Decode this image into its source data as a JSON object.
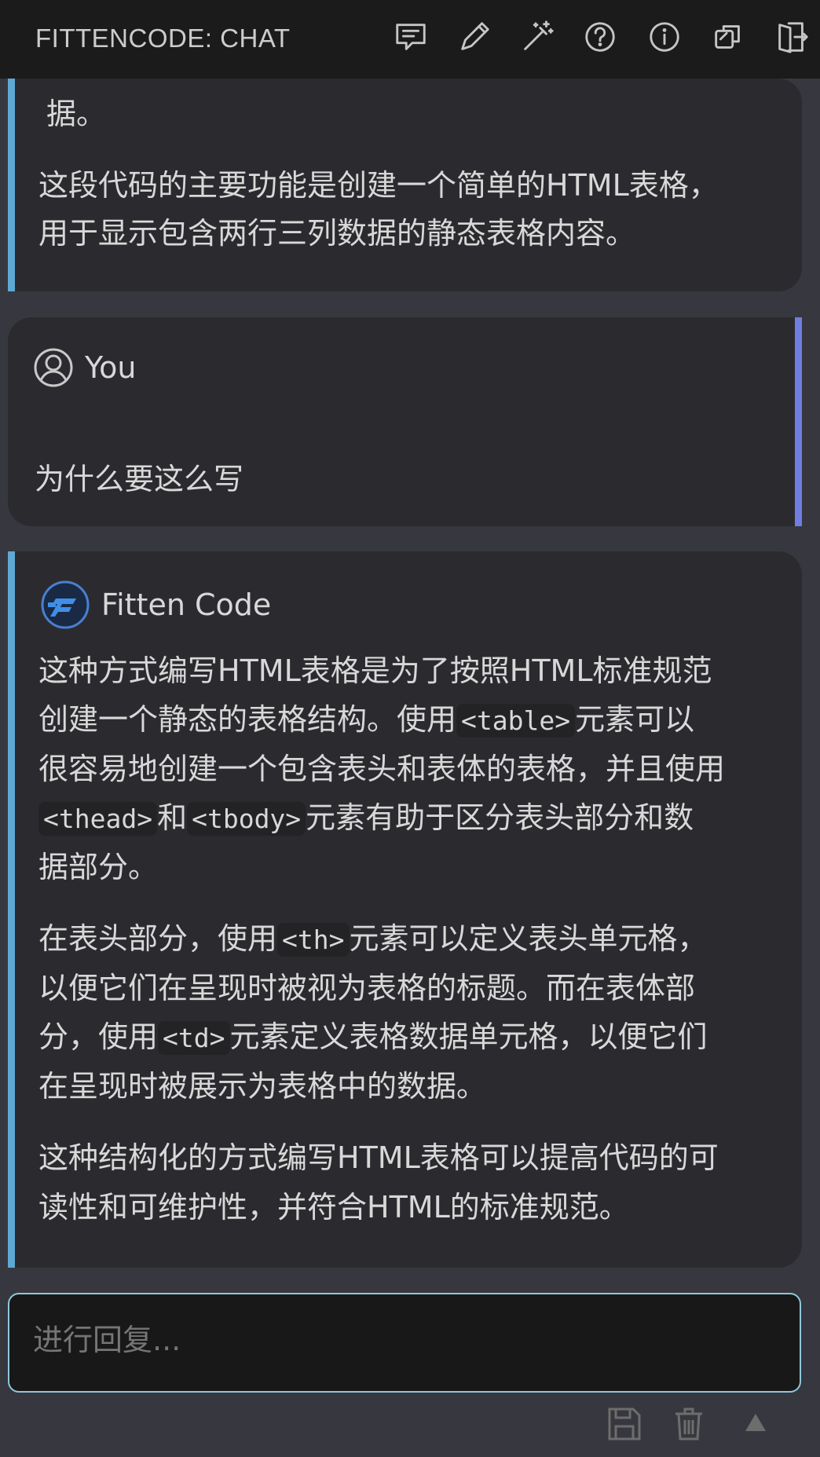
{
  "panel_title": "FITTENCODE: CHAT",
  "toolbar_icons": [
    "new-chat-icon",
    "edit-icon",
    "magic-wand-icon",
    "help-icon",
    "info-icon",
    "copy-icon",
    "exit-icon"
  ],
  "messages": {
    "ai_prev": {
      "line_top": "据。",
      "p2_l1": "这段代码的主要功能是创建一个简单的HTML表格，",
      "p2_l2": "用于显示包含两行三列数据的静态表格内容。"
    },
    "user": {
      "author": "You",
      "text": "为什么要这么写"
    },
    "ai": {
      "author": "Fitten Code",
      "p1_l1": "这种方式编写HTML表格是为了按照HTML标准规范",
      "p1_l2a": "创建一个静态的表格结构。使用",
      "p1_code1": "<table>",
      "p1_l2b": "元素可以",
      "p1_l3": "很容易地创建一个包含表头和表体的表格，并且使用",
      "p1_code2": "<thead>",
      "p1_l4a": "和",
      "p1_code3": "<tbody>",
      "p1_l4b": "元素有助于区分表头部分和数",
      "p1_l5": "据部分。",
      "p2_l1a": "在表头部分，使用",
      "p2_code1": "<th>",
      "p2_l1b": "元素可以定义表头单元格，",
      "p2_l2": "以便它们在呈现时被视为表格的标题。而在表体部",
      "p2_l3a": "分，使用",
      "p2_code2": "<td>",
      "p2_l3b": "元素定义表格数据单元格，以便它们",
      "p2_l4": "在呈现时被展示为表格中的数据。",
      "p3_l1": "这种结构化的方式编写HTML表格可以提高代码的可",
      "p3_l2": "读性和可维护性，并符合HTML的标准规范。"
    }
  },
  "reply": {
    "placeholder": "进行回复..."
  },
  "bottom_icons": [
    "save-icon",
    "trash-icon",
    "scroll-up-icon"
  ],
  "colors": {
    "ai_accent": "#5fa8d3",
    "user_accent": "#6f7ee0",
    "input_border": "#8fc7d9"
  }
}
